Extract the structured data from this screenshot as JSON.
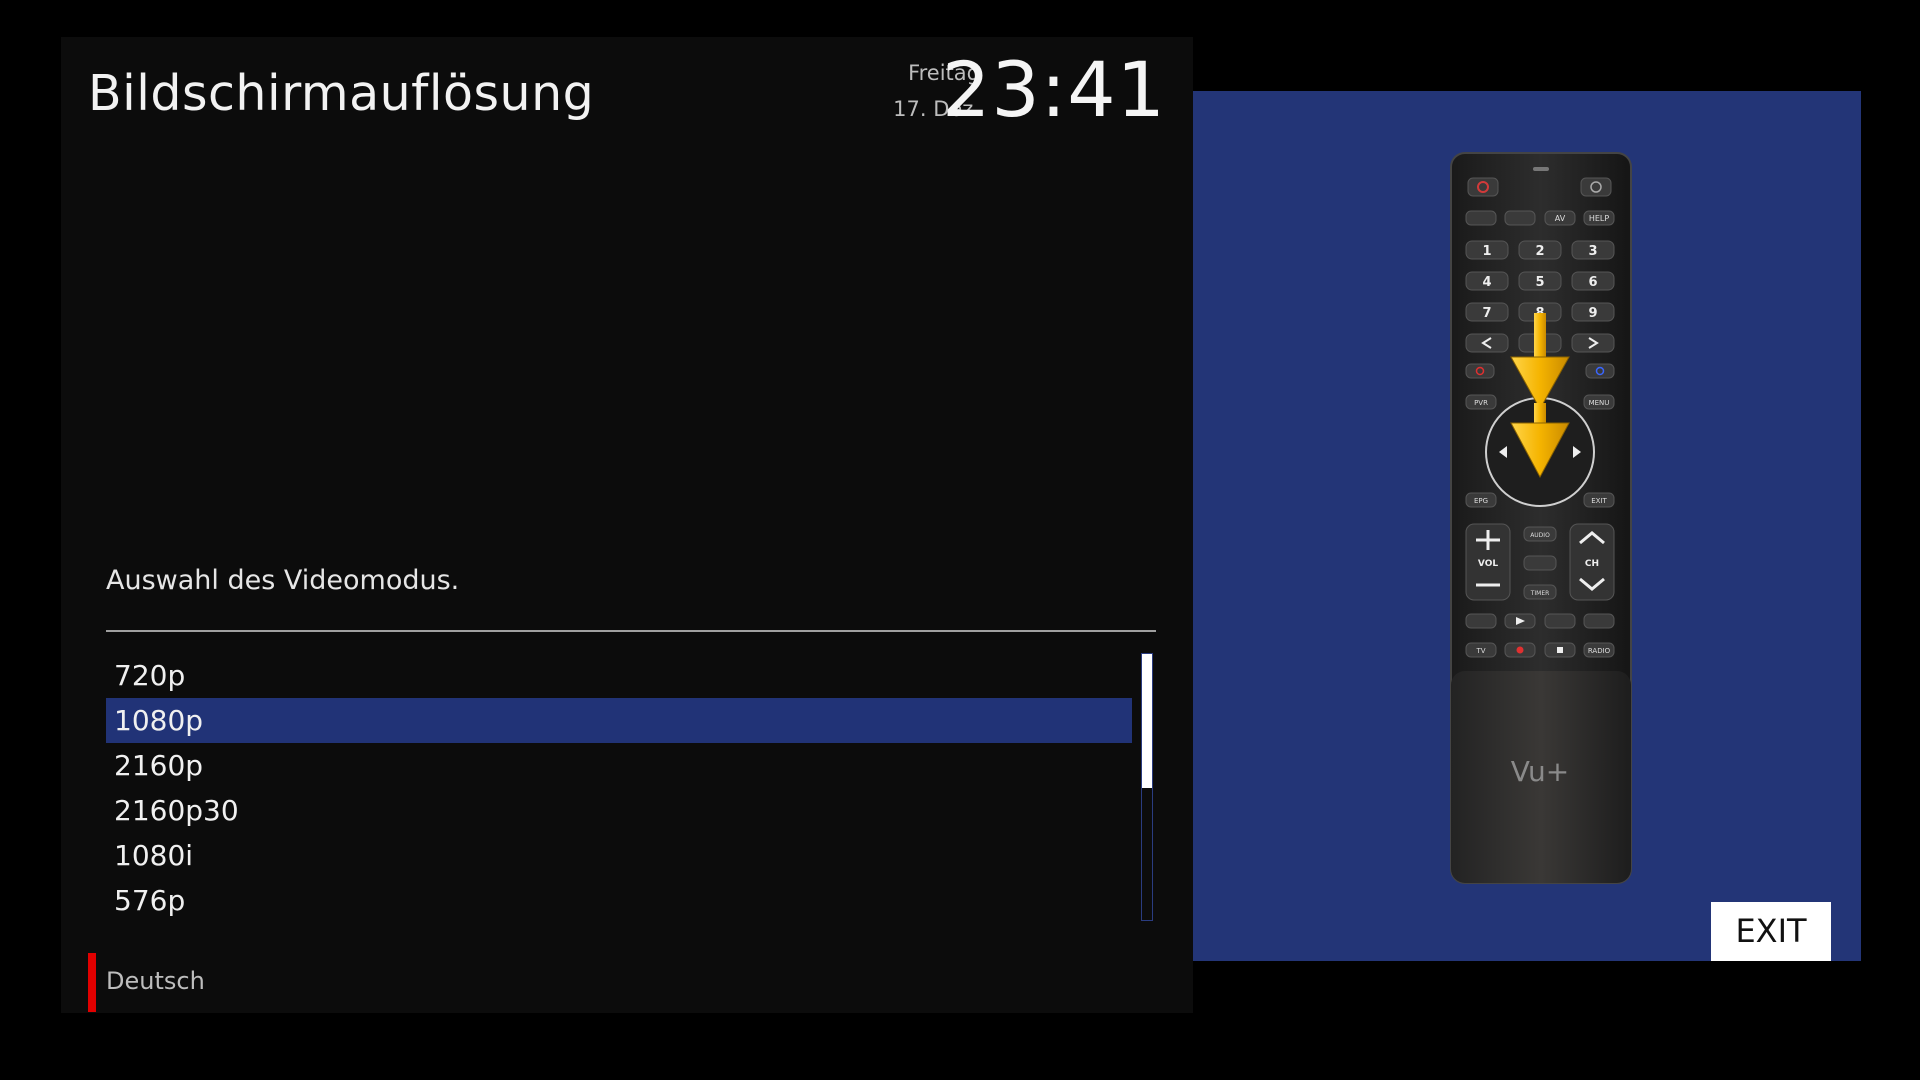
{
  "header": {
    "title": "Bildschirmauflösung",
    "weekday": "Freitag",
    "date": "17. Dez.",
    "time": "23:41"
  },
  "main": {
    "description": "Auswahl des Videomodus.",
    "modes": [
      "720p",
      "1080p",
      "2160p",
      "2160p30",
      "1080i",
      "576p"
    ],
    "selected_mode": "1080p"
  },
  "footer": {
    "language": "Deutsch"
  },
  "remote": {
    "brand": "Vu+",
    "buttons": {
      "av": "AV",
      "help": "HELP",
      "n1": "1",
      "n2": "2",
      "n3": "3",
      "n4": "4",
      "n5": "5",
      "n6": "6",
      "n7": "7",
      "n8": "8",
      "n9": "9",
      "pvr": "PVR",
      "menu": "MENU",
      "epg": "EPG",
      "exit": "EXIT",
      "audio": "AUDIO",
      "timer": "TIMER",
      "vol": "VOL",
      "ch": "CH",
      "tv": "TV",
      "radio": "RADIO"
    },
    "exit_label": "EXIT"
  },
  "colors": {
    "panel_bg": "#0c0c0c",
    "highlight": "#213377",
    "remote_panel_bg": "#233577",
    "language_marker": "#e10000",
    "arrow_gold": "#f5b400"
  }
}
